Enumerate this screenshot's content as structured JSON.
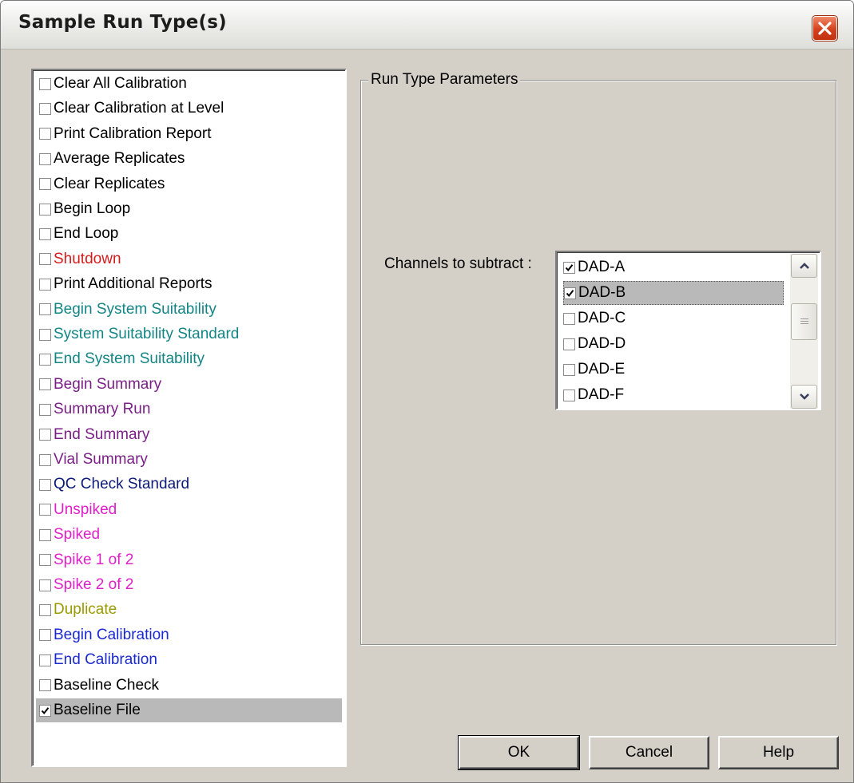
{
  "window": {
    "title": "Sample Run Type(s)",
    "close_icon": "close-icon"
  },
  "colors": {
    "black": "#000000",
    "red": "#d41c1c",
    "teal": "#138585",
    "purple": "#7a1f86",
    "navy": "#0d1a78",
    "magenta": "#e020c8",
    "olive": "#9a9a00",
    "blue": "#1a2ad0",
    "selection": "#b9b9b9"
  },
  "run_types": [
    {
      "label": "Clear All Calibration",
      "color": "#000000",
      "checked": false,
      "selected": false
    },
    {
      "label": "Clear Calibration at Level",
      "color": "#000000",
      "checked": false,
      "selected": false
    },
    {
      "label": "Print Calibration Report",
      "color": "#000000",
      "checked": false,
      "selected": false
    },
    {
      "label": "Average Replicates",
      "color": "#000000",
      "checked": false,
      "selected": false
    },
    {
      "label": "Clear Replicates",
      "color": "#000000",
      "checked": false,
      "selected": false
    },
    {
      "label": "Begin Loop",
      "color": "#000000",
      "checked": false,
      "selected": false
    },
    {
      "label": "End Loop",
      "color": "#000000",
      "checked": false,
      "selected": false
    },
    {
      "label": "Shutdown",
      "color": "#d41c1c",
      "checked": false,
      "selected": false
    },
    {
      "label": "Print Additional Reports",
      "color": "#000000",
      "checked": false,
      "selected": false
    },
    {
      "label": "Begin System Suitability",
      "color": "#138585",
      "checked": false,
      "selected": false
    },
    {
      "label": "System Suitability Standard",
      "color": "#138585",
      "checked": false,
      "selected": false
    },
    {
      "label": "End System Suitability",
      "color": "#138585",
      "checked": false,
      "selected": false
    },
    {
      "label": "Begin Summary",
      "color": "#7a1f86",
      "checked": false,
      "selected": false
    },
    {
      "label": "Summary Run",
      "color": "#7a1f86",
      "checked": false,
      "selected": false
    },
    {
      "label": "End Summary",
      "color": "#7a1f86",
      "checked": false,
      "selected": false
    },
    {
      "label": "Vial Summary",
      "color": "#7a1f86",
      "checked": false,
      "selected": false
    },
    {
      "label": "QC Check Standard",
      "color": "#0d1a78",
      "checked": false,
      "selected": false
    },
    {
      "label": "Unspiked",
      "color": "#e020c8",
      "checked": false,
      "selected": false
    },
    {
      "label": "Spiked",
      "color": "#e020c8",
      "checked": false,
      "selected": false
    },
    {
      "label": "Spike 1 of 2",
      "color": "#e020c8",
      "checked": false,
      "selected": false
    },
    {
      "label": "Spike 2 of 2",
      "color": "#e020c8",
      "checked": false,
      "selected": false
    },
    {
      "label": "Duplicate",
      "color": "#9a9a00",
      "checked": false,
      "selected": false
    },
    {
      "label": "Begin Calibration",
      "color": "#1a2ad0",
      "checked": false,
      "selected": false
    },
    {
      "label": "End Calibration",
      "color": "#1a2ad0",
      "checked": false,
      "selected": false
    },
    {
      "label": "Baseline Check",
      "color": "#000000",
      "checked": false,
      "selected": false
    },
    {
      "label": "Baseline File",
      "color": "#000000",
      "checked": true,
      "selected": true
    }
  ],
  "parameters": {
    "group_title": "Run Type Parameters",
    "channels_label": "Channels to subtract :",
    "channels": [
      {
        "label": "DAD-A",
        "checked": true,
        "selected": false
      },
      {
        "label": "DAD-B",
        "checked": true,
        "selected": true
      },
      {
        "label": "DAD-C",
        "checked": false,
        "selected": false
      },
      {
        "label": "DAD-D",
        "checked": false,
        "selected": false
      },
      {
        "label": "DAD-E",
        "checked": false,
        "selected": false
      },
      {
        "label": "DAD-F",
        "checked": false,
        "selected": false
      }
    ]
  },
  "buttons": {
    "ok": "OK",
    "cancel": "Cancel",
    "help": "Help"
  }
}
